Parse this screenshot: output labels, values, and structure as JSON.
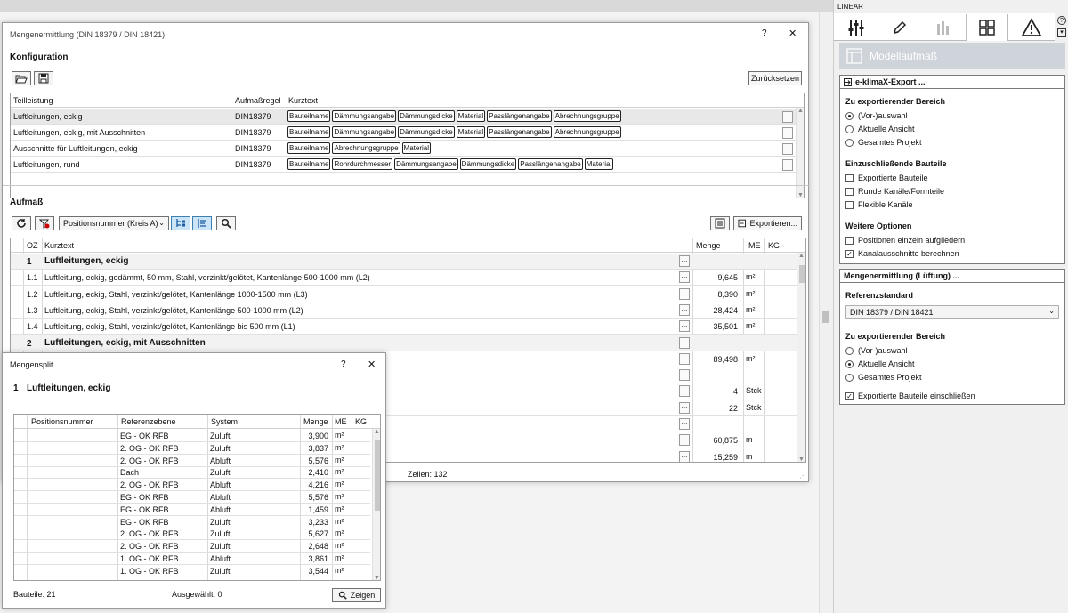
{
  "main_dialog": {
    "title": "Mengenermittlung (DIN 18379 / DIN 18421)",
    "help": "?",
    "close": "✕",
    "konfiguration": {
      "heading": "Konfiguration",
      "reset_label": "Zurücksetzen",
      "columns": [
        "Teilleistung",
        "Aufmaßregel",
        "Kurztext"
      ],
      "rows": [
        {
          "teilleistung": "Luftleitungen, eckig",
          "regel": "DIN18379",
          "tags": [
            "Bauteilname",
            "Dämmungsangabe",
            "Dämmungsdicke",
            "Material",
            "Passlängenangabe",
            "Abrechnungsgruppe"
          ],
          "selected": true
        },
        {
          "teilleistung": "Luftleitungen, eckig, mit Ausschnitten",
          "regel": "DIN18379",
          "tags": [
            "Bauteilname",
            "Dämmungsangabe",
            "Dämmungsdicke",
            "Material",
            "Passlängenangabe",
            "Abrechnungsgruppe"
          ]
        },
        {
          "teilleistung": "Ausschnitte für Luftleitungen, eckig",
          "regel": "DIN18379",
          "tags": [
            "Bauteilname",
            "Abrechnungsgruppe",
            "Material"
          ]
        },
        {
          "teilleistung": "Luftleitungen, rund",
          "regel": "DIN18379",
          "tags": [
            "Bauteilname",
            "Rohrdurchmesser",
            "Dämmungsangabe",
            "Dämmungsdicke",
            "Passlängenangabe",
            "Material"
          ]
        }
      ],
      "ellipsis": "..."
    },
    "aufmass": {
      "heading": "Aufmaß",
      "sort_select": "Positionsnummer (Kreis A)",
      "export_label": "Exportieren...",
      "columns": [
        "OZ",
        "Kurztext",
        "Menge",
        "ME",
        "KG"
      ],
      "rows": [
        {
          "oz": "1",
          "text": "Luftleitungen, eckig",
          "menge": "",
          "me": "",
          "group": true
        },
        {
          "oz": "1.1",
          "text": "Luftleitung, eckig, gedämmt, 50 mm, Stahl, verzinkt/gelötet, Kantenlänge 500-1000 mm (L2)",
          "menge": "9,645",
          "me": "m²"
        },
        {
          "oz": "1.2",
          "text": "Luftleitung, eckig, Stahl, verzinkt/gelötet, Kantenlänge 1000-1500 mm (L3)",
          "menge": "8,390",
          "me": "m²"
        },
        {
          "oz": "1.3",
          "text": "Luftleitung, eckig, Stahl, verzinkt/gelötet, Kantenlänge 500-1000 mm (L2)",
          "menge": "28,424",
          "me": "m²"
        },
        {
          "oz": "1.4",
          "text": "Luftleitung, eckig, Stahl, verzinkt/gelötet, Kantenlänge bis 500 mm (L1)",
          "menge": "35,501",
          "me": "m²"
        },
        {
          "oz": "2",
          "text": "Luftleitungen, eckig, mit Ausschnitten",
          "menge": "",
          "me": "",
          "group": true
        },
        {
          "oz": "",
          "text": "",
          "menge": "89,498",
          "me": "m²"
        },
        {
          "oz": "",
          "text": "",
          "menge": "",
          "me": ""
        },
        {
          "oz": "",
          "text": "",
          "menge": "4",
          "me": "Stck"
        },
        {
          "oz": "",
          "text": "",
          "menge": "22",
          "me": "Stck"
        },
        {
          "oz": "",
          "text": "",
          "menge": "",
          "me": ""
        },
        {
          "oz": "",
          "text": "",
          "menge": "60,875",
          "me": "m"
        },
        {
          "oz": "",
          "text": "",
          "menge": "15,259",
          "me": "m"
        }
      ],
      "footer": "Zeilen: 132"
    }
  },
  "split_dialog": {
    "title": "Mengensplit",
    "help": "?",
    "close": "✕",
    "header_num": "1",
    "header_text": "Luftleitungen, eckig",
    "columns": [
      "Positionsnummer",
      "Referenzebene",
      "System",
      "Menge",
      "ME",
      "KG"
    ],
    "rows": [
      {
        "ebene": "EG - OK RFB",
        "system": "Zuluft",
        "menge": "3,900",
        "me": "m²"
      },
      {
        "ebene": "2. OG - OK RFB",
        "system": "Zuluft",
        "menge": "3,837",
        "me": "m²"
      },
      {
        "ebene": "2. OG - OK RFB",
        "system": "Abluft",
        "menge": "5,576",
        "me": "m²"
      },
      {
        "ebene": "Dach",
        "system": "Zuluft",
        "menge": "2,410",
        "me": "m²"
      },
      {
        "ebene": "2. OG - OK RFB",
        "system": "Abluft",
        "menge": "4,216",
        "me": "m²"
      },
      {
        "ebene": "EG - OK RFB",
        "system": "Abluft",
        "menge": "5,576",
        "me": "m²"
      },
      {
        "ebene": "EG - OK RFB",
        "system": "Abluft",
        "menge": "1,459",
        "me": "m²"
      },
      {
        "ebene": "EG - OK RFB",
        "system": "Zuluft",
        "menge": "3,233",
        "me": "m²"
      },
      {
        "ebene": "2. OG - OK RFB",
        "system": "Zuluft",
        "menge": "5,627",
        "me": "m²"
      },
      {
        "ebene": "2. OG - OK RFB",
        "system": "Zuluft",
        "menge": "2,648",
        "me": "m²"
      },
      {
        "ebene": "1. OG - OK RFB",
        "system": "Abluft",
        "menge": "3,861",
        "me": "m²"
      },
      {
        "ebene": "1. OG - OK RFB",
        "system": "Zuluft",
        "menge": "3,544",
        "me": "m²"
      }
    ],
    "footer_count": "Bauteile: 21",
    "footer_selected": "Ausgewählt: 0",
    "show_label": "Zeigen"
  },
  "right_panel": {
    "app_title": "LINEAR",
    "help": "?",
    "page_title": "Modellaufmaß",
    "export_section": {
      "title": "e-klimaX-Export ...",
      "area_heading": "Zu exportierender Bereich",
      "area_options": [
        "(Vor-)auswahl",
        "Aktuelle Ansicht",
        "Gesamtes Projekt"
      ],
      "area_selected": 0,
      "include_heading": "Einzuschließende Bauteile",
      "include_options": [
        {
          "label": "Exportierte Bauteile",
          "checked": false
        },
        {
          "label": "Runde Kanäle/Formteile",
          "checked": false
        },
        {
          "label": "Flexible Kanäle",
          "checked": false
        }
      ],
      "more_heading": "Weitere Optionen",
      "more_options": [
        {
          "label": "Positionen einzeln aufgliedern",
          "checked": false
        },
        {
          "label": "Kanalausschnitte berechnen",
          "checked": true
        }
      ]
    },
    "quantity_section": {
      "title": "Mengenermittlung (Lüftung) ...",
      "ref_heading": "Referenzstandard",
      "ref_value": "DIN 18379 / DIN 18421",
      "area_heading": "Zu exportierender Bereich",
      "area_options": [
        "(Vor-)auswahl",
        "Aktuelle Ansicht",
        "Gesamtes Projekt"
      ],
      "area_selected": 1,
      "include_label": "Exportierte Bauteile einschließen",
      "include_checked": true
    }
  }
}
